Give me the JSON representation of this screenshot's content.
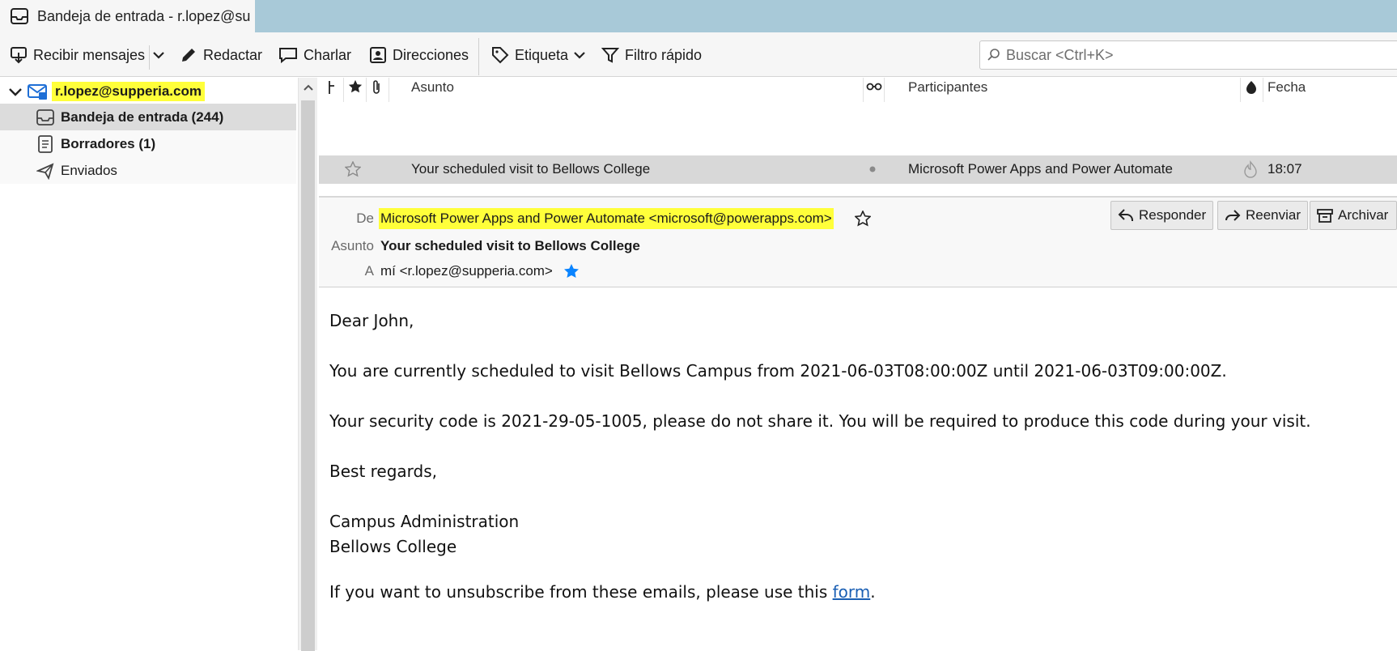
{
  "tab": {
    "title": "Bandeja de entrada - r.lopez@su"
  },
  "toolbar": {
    "get_messages": "Recibir mensajes",
    "compose": "Redactar",
    "chat": "Charlar",
    "address_book": "Direcciones",
    "tag": "Etiqueta",
    "quick_filter": "Filtro rápido",
    "search_placeholder": "Buscar <Ctrl+K>"
  },
  "folders": {
    "account": "r.lopez@supperia.com",
    "items": [
      {
        "label": "Bandeja de entrada (244)",
        "icon": "inbox-icon",
        "bold": true,
        "selected": true
      },
      {
        "label": "Borradores (1)",
        "icon": "drafts-icon",
        "bold": true,
        "selected": false
      },
      {
        "label": "Enviados",
        "icon": "sent-icon",
        "bold": false,
        "selected": false
      }
    ]
  },
  "thread_columns": {
    "subject": "Asunto",
    "participants": "Participantes",
    "date": "Fecha"
  },
  "messages": [
    {
      "subject": "Your scheduled visit to Bellows College",
      "participants": "Microsoft Power Apps and Power Automate",
      "date": "18:07"
    }
  ],
  "header": {
    "from_label": "De",
    "from_value": "Microsoft Power Apps and Power Automate <microsoft@powerapps.com>",
    "subject_label": "Asunto",
    "subject_value": "Your scheduled visit to Bellows College",
    "to_label": "A",
    "to_value": "mí <r.lopez@supperia.com>",
    "reply": "Responder",
    "forward": "Reenviar",
    "archive": "Archivar"
  },
  "body": {
    "greeting": "Dear John,",
    "line1": "You are currently scheduled to visit Bellows Campus from 2021-06-03T08:00:00Z until 2021-06-03T09:00:00Z.",
    "line2": "Your security code is 2021-29-05-1005, please do not share it. You will be required to produce this code during your visit.",
    "regards": "Best regards,",
    "sig1": "Campus Administration",
    "sig2": "Bellows College",
    "unsub_prefix": "If you want to unsubscribe from these emails, please use this ",
    "unsub_link": "form",
    "unsub_suffix": "."
  },
  "colors": {
    "highlight": "#ffff3a",
    "tabbar": "#a8c9d8",
    "selected_row": "#dcdcdc",
    "link": "#1a5fb4",
    "star_blue": "#0a84ff"
  }
}
